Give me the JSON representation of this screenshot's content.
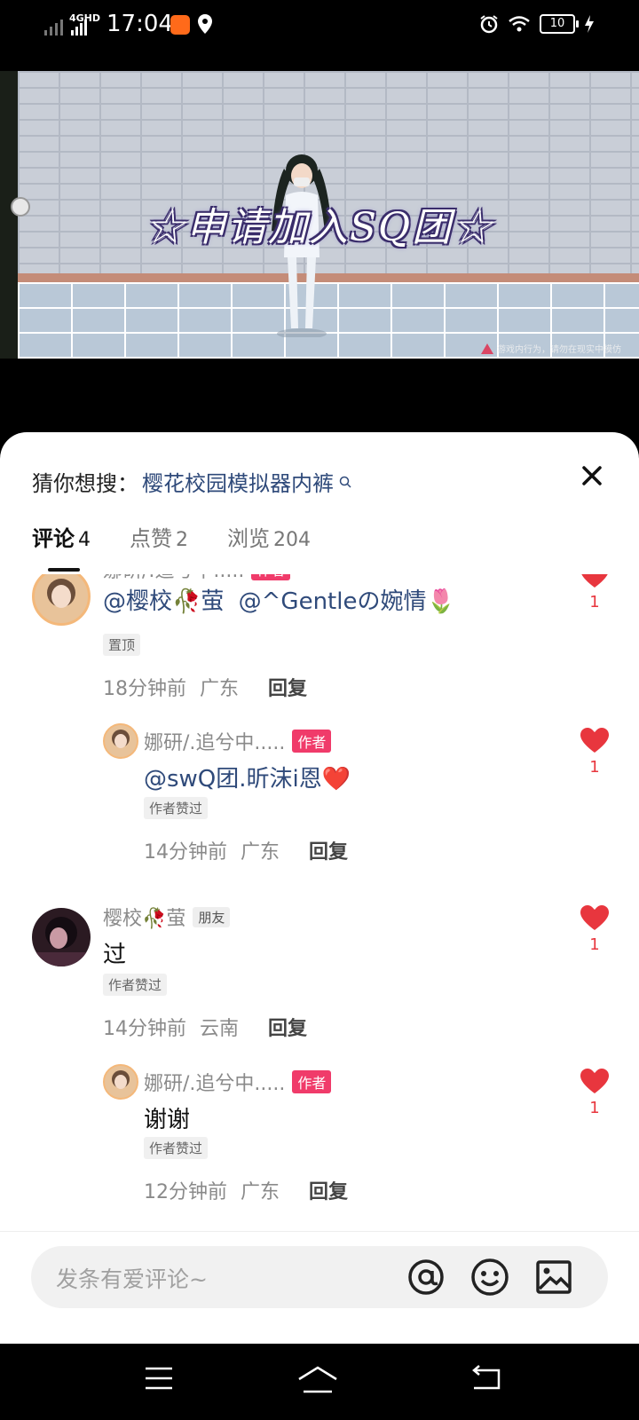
{
  "status_bar": {
    "network": "4GHD",
    "time": "17:04",
    "battery": "10"
  },
  "video": {
    "caption": "☆申请加入SQ团☆",
    "warning": "游戏内行为，请勿在现实中模仿"
  },
  "sheet": {
    "guess_prefix": "猜你想搜：",
    "guess_query": "樱花校园模拟器内裤",
    "tabs": [
      {
        "label": "评论",
        "count": "4"
      },
      {
        "label": "点赞",
        "count": "2"
      },
      {
        "label": "浏览",
        "count": "204"
      }
    ]
  },
  "comments": [
    {
      "name": "娜研/.追兮中.....",
      "badge": "作者",
      "text_mention_1": "@樱校🥀萤",
      "text_mention_2": "@^Gentleの婉情🌷",
      "tag": "置顶",
      "time": "18分钟前",
      "location": "广东",
      "reply": "回复",
      "likes": "1"
    },
    {
      "name": "娜研/.追兮中.....",
      "badge": "作者",
      "text_mention": "@swQ团.昕沫i恩❤️",
      "tag": "作者赞过",
      "time": "14分钟前",
      "location": "广东",
      "reply": "回复",
      "likes": "1"
    },
    {
      "name": "樱校🥀萤",
      "badge": "朋友",
      "text": "过",
      "tag": "作者赞过",
      "time": "14分钟前",
      "location": "云南",
      "reply": "回复",
      "likes": "1"
    },
    {
      "name": "娜研/.追兮中.....",
      "badge": "作者",
      "text": "谢谢",
      "tag": "作者赞过",
      "time": "12分钟前",
      "location": "广东",
      "reply": "回复",
      "likes": "1"
    }
  ],
  "input": {
    "placeholder": "发条有爱评论~"
  },
  "colors": {
    "accent_like": "#e8363e",
    "author_badge": "#f03b6a",
    "mention": "#2f4a7a"
  }
}
